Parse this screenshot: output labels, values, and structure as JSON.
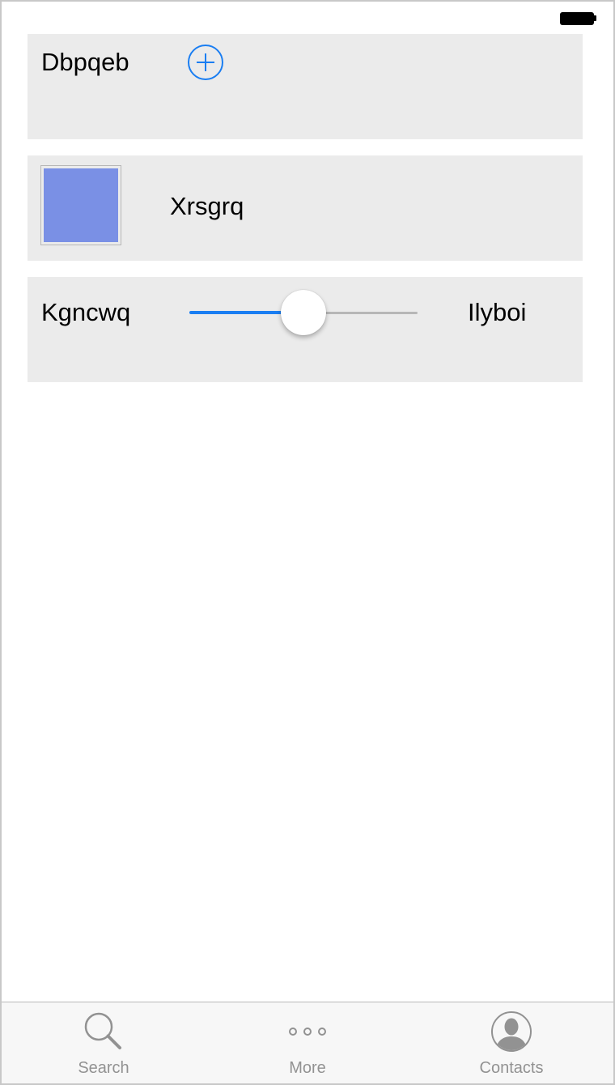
{
  "rows": {
    "add_row": {
      "label": "Dbpqeb",
      "button_icon": "plus-circle-icon"
    },
    "color_row": {
      "label": "Xrsgrq",
      "swatch_color": "#7a90e5"
    },
    "slider_row": {
      "min_label": "Kgncwq",
      "max_label": "Ilyboi",
      "value": 0.5
    }
  },
  "tabbar": {
    "tabs": [
      {
        "label": "Search",
        "icon": "search-icon"
      },
      {
        "label": "More",
        "icon": "more-dots-icon"
      },
      {
        "label": "Contacts",
        "icon": "contact-avatar-icon"
      }
    ]
  },
  "colors": {
    "accent": "#1a7ef2",
    "cell_background": "#ebebeb",
    "tab_inactive": "#929292"
  }
}
